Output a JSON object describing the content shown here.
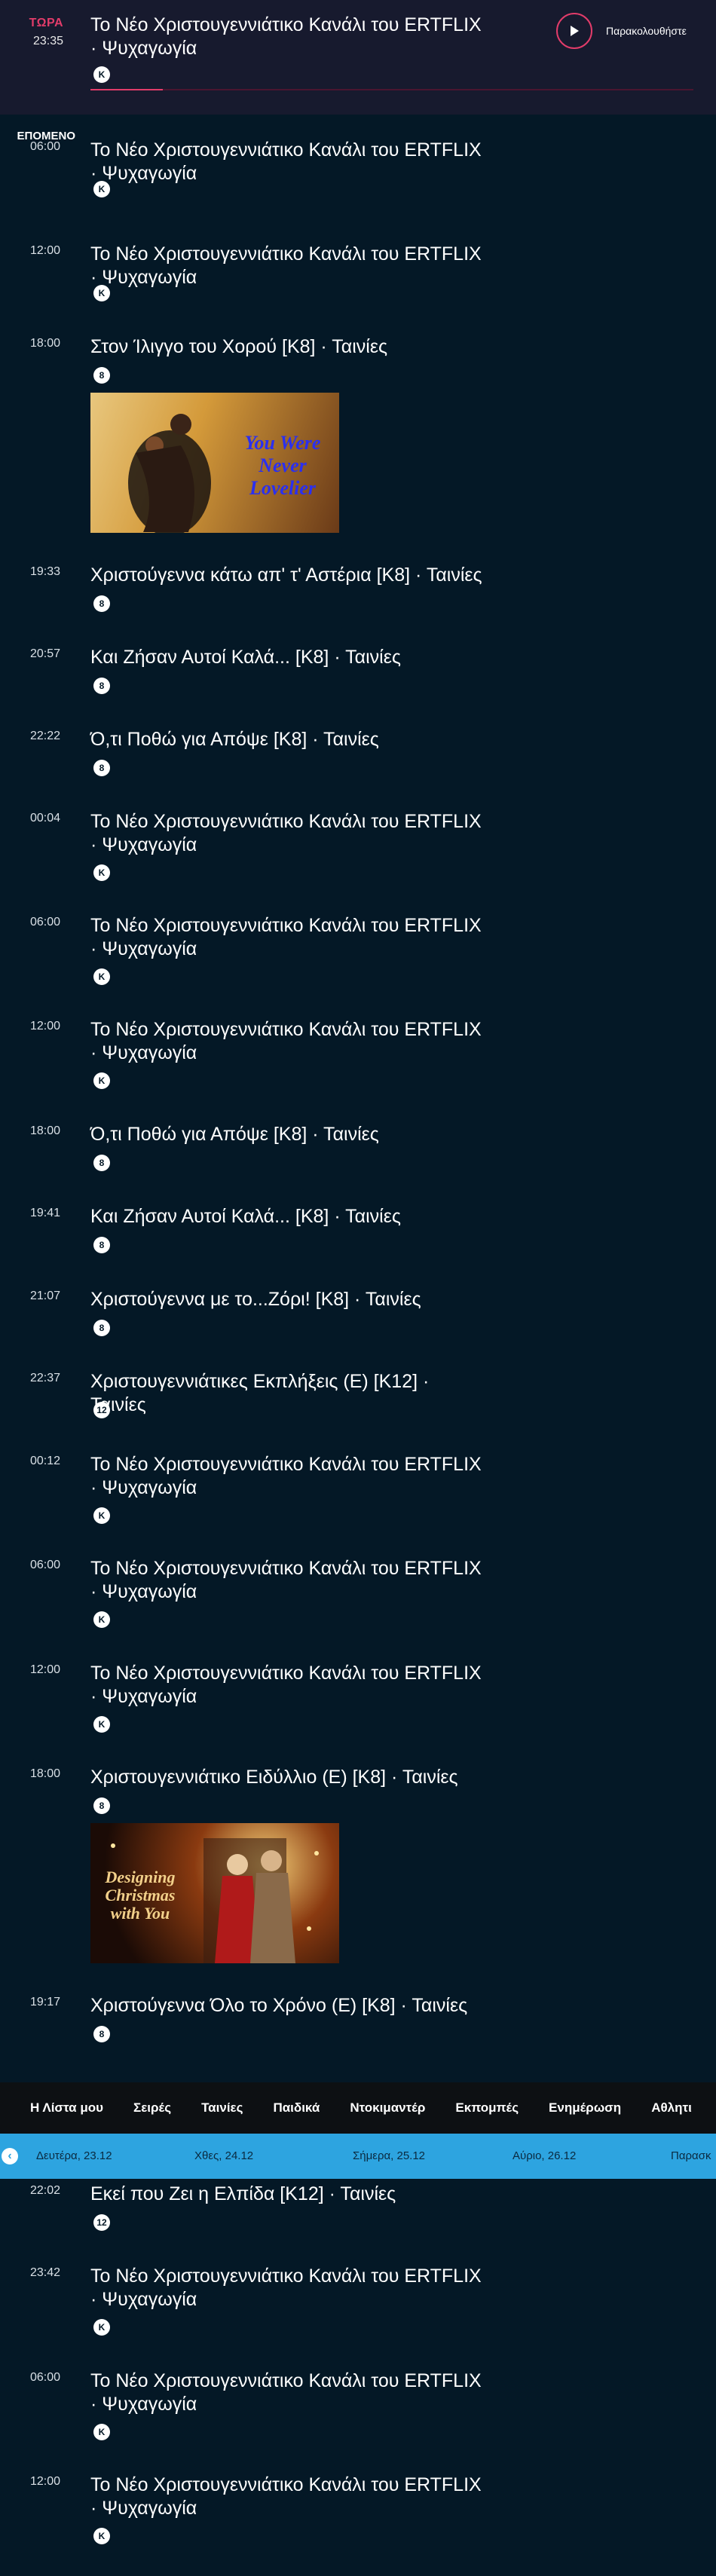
{
  "now": {
    "label": "ΤΩΡΑ",
    "time": "23:35",
    "title": "Το Νέο Χριστουγεννιάτικο Κανάλι του ERTFLIX · Ψυχαγωγία",
    "rating": "K",
    "progress": 0.12,
    "watch_label": "Παρακολουθήστε"
  },
  "next_label": "ΕΠΟΜΕΝΟ",
  "schedule": [
    {
      "time": "06:00",
      "title": "Το Νέο Χριστουγεννιάτικο Κανάλι του ERTFLIX · Ψυχαγωγία",
      "rating": "K"
    },
    {
      "time": "12:00",
      "title": "Το Νέο Χριστουγεννιάτικο Κανάλι του ERTFLIX · Ψυχαγωγία",
      "rating": "K"
    },
    {
      "time": "18:00",
      "title": "Στον Ίλιγγο του Χορού [K8] · Ταινίες",
      "rating": "8",
      "thumb_text": "You Were Never Lovelier"
    },
    {
      "time": "19:33",
      "title": "Χριστούγεννα κάτω απ' τ' Αστέρια [K8] · Ταινίες",
      "rating": "8"
    },
    {
      "time": "20:57",
      "title": "Και Ζήσαν Αυτοί Καλά... [K8] · Ταινίες",
      "rating": "8"
    },
    {
      "time": "22:22",
      "title": "Ό,τι Ποθώ για Απόψε [K8] · Ταινίες",
      "rating": "8"
    },
    {
      "time": "00:04",
      "title": "Το Νέο Χριστουγεννιάτικο Κανάλι του ERTFLIX · Ψυχαγωγία",
      "rating": "K"
    },
    {
      "time": "06:00",
      "title": "Το Νέο Χριστουγεννιάτικο Κανάλι του ERTFLIX · Ψυχαγωγία",
      "rating": "K"
    },
    {
      "time": "12:00",
      "title": "Το Νέο Χριστουγεννιάτικο Κανάλι του ERTFLIX · Ψυχαγωγία",
      "rating": "K"
    },
    {
      "time": "18:00",
      "title": "Ό,τι Ποθώ για Απόψε [K8] · Ταινίες",
      "rating": "8"
    },
    {
      "time": "19:41",
      "title": "Και Ζήσαν Αυτοί Καλά... [K8] · Ταινίες",
      "rating": "8"
    },
    {
      "time": "21:07",
      "title": "Χριστούγεννα με το...Ζόρι! [K8] · Ταινίες",
      "rating": "8"
    },
    {
      "time": "22:37",
      "title": "Χριστουγεννιάτικες Εκπλήξεις (E) [K12] · Ταινίες",
      "rating": "12"
    },
    {
      "time": "00:12",
      "title": "Το Νέο Χριστουγεννιάτικο Κανάλι του ERTFLIX · Ψυχαγωγία",
      "rating": "K"
    },
    {
      "time": "06:00",
      "title": "Το Νέο Χριστουγεννιάτικο Κανάλι του ERTFLIX · Ψυχαγωγία",
      "rating": "K"
    },
    {
      "time": "12:00",
      "title": "Το Νέο Χριστουγεννιάτικο Κανάλι του ERTFLIX · Ψυχαγωγία",
      "rating": "K"
    },
    {
      "time": "18:00",
      "title": "Χριστουγεννιάτικο Ειδύλλιο (E) [K8] · Ταινίες",
      "rating": "8",
      "thumb_text": "Designing Christmas with You"
    },
    {
      "time": "19:17",
      "title": "Χριστούγεννα Όλο το Χρόνο (E) [K8] · Ταινίες",
      "rating": "8"
    },
    {
      "time": "22:02",
      "title": "Εκεί που Ζει η Ελπίδα [K12] · Ταινίες",
      "rating": "12"
    },
    {
      "time": "23:42",
      "title": "Το Νέο Χριστουγεννιάτικο Κανάλι του ERTFLIX · Ψυχαγωγία",
      "rating": "K"
    },
    {
      "time": "06:00",
      "title": "Το Νέο Χριστουγεννιάτικο Κανάλι του ERTFLIX · Ψυχαγωγία",
      "rating": "K"
    },
    {
      "time": "12:00",
      "title": "Το Νέο Χριστουγεννιάτικο Κανάλι του ERTFLIX · Ψυχαγωγία",
      "rating": "K"
    }
  ],
  "nav": {
    "tabs": [
      "Η Λίστα μου",
      "Σειρές",
      "Ταινίες",
      "Παιδικά",
      "Ντοκιμαντέρ",
      "Εκπομπές",
      "Ενημέρωση",
      "Αθλητι"
    ]
  },
  "dates": {
    "items": [
      "Δευτέρα, 23.12",
      "Χθες, 24.12",
      "Σήμερα, 25.12",
      "Αύριο, 26.12",
      "Παρασκ"
    ]
  },
  "colors": {
    "accent": "#e23c6a",
    "background": "#041826",
    "datebar": "#2da4e0"
  }
}
